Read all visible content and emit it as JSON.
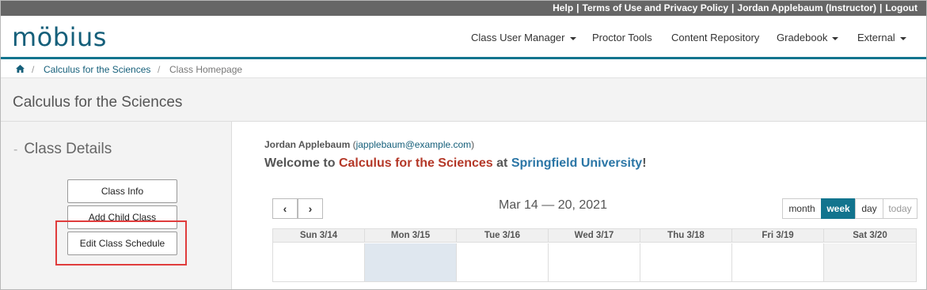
{
  "top_links": {
    "help": "Help",
    "terms": "Terms of Use and Privacy Policy",
    "user": "Jordan Applebaum (Instructor)",
    "logout": "Logout",
    "separator": "|"
  },
  "brand": {
    "logo_text": "möbius"
  },
  "nav": {
    "class_user_manager": "Class User Manager",
    "proctor_tools": "Proctor Tools",
    "content_repository": "Content Repository",
    "gradebook": "Gradebook",
    "external": "External"
  },
  "breadcrumb": {
    "home_icon": "home-icon",
    "separator": "/",
    "class_link": "Calculus for the Sciences",
    "current": "Class Homepage"
  },
  "page": {
    "title": "Calculus for the Sciences"
  },
  "sidebar": {
    "dash": "-",
    "heading": "Class Details",
    "buttons": {
      "class_info": "Class Info",
      "add_child_class": "Add Child Class",
      "edit_class_schedule": "Edit Class Schedule"
    }
  },
  "main": {
    "user_name": "Jordan Applebaum",
    "user_email_open": "(",
    "user_email": "japplebaum@example.com",
    "user_email_close": ")",
    "welcome_prefix": "Welcome to",
    "welcome_class": "Calculus for the Sciences",
    "welcome_at": "at",
    "welcome_university": "Springfield University",
    "welcome_suffix": "!"
  },
  "calendar": {
    "prev_glyph": "‹",
    "next_glyph": "›",
    "title": "Mar 14 — 20, 2021",
    "views": {
      "month": "month",
      "week": "week",
      "day": "day",
      "today": "today"
    },
    "active_view": "week",
    "days": [
      {
        "label": "Sun 3/14"
      },
      {
        "label": "Mon 3/15"
      },
      {
        "label": "Tue 3/16"
      },
      {
        "label": "Wed 3/17"
      },
      {
        "label": "Thu 3/18"
      },
      {
        "label": "Fri 3/19"
      },
      {
        "label": "Sat 3/20"
      }
    ]
  },
  "colors": {
    "accent": "#12748e",
    "class_name": "#b43828",
    "university": "#2b76a6",
    "highlight": "#e03c3c",
    "top_bar": "#666666"
  }
}
